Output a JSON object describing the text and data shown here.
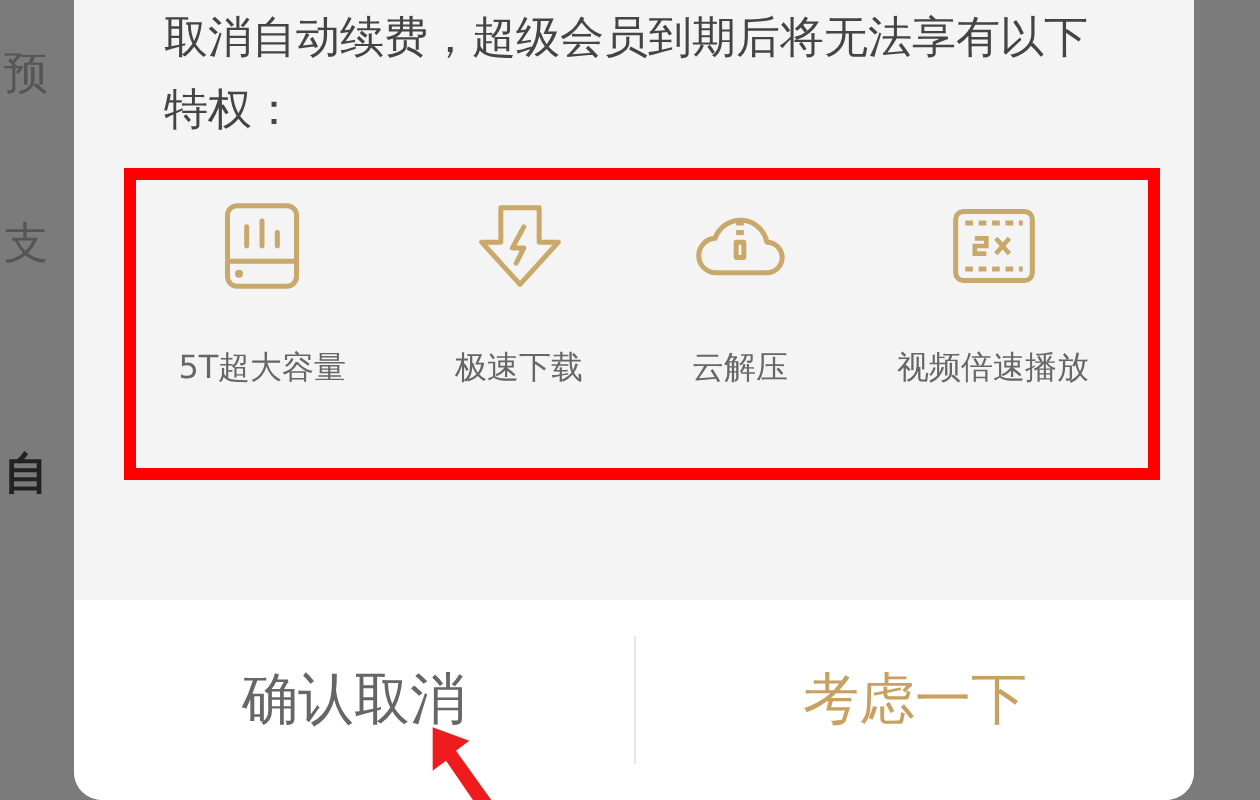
{
  "background_page": {
    "rows": [
      {
        "label": "预",
        "kind": "normal"
      },
      {
        "label": "支",
        "kind": "normal"
      },
      {
        "label": "自",
        "kind": "heading"
      }
    ]
  },
  "dialog": {
    "message": "取消自动续费，超级会员到期后将无法享有以下特权：",
    "privileges": [
      {
        "kind": "storage",
        "label": "5T超大容量"
      },
      {
        "kind": "download",
        "label": "极速下载"
      },
      {
        "kind": "cloud",
        "label": "云解压"
      },
      {
        "kind": "video",
        "label": "视频倍速播放"
      }
    ],
    "buttons": [
      {
        "label": "确认取消",
        "kind": "secondary"
      },
      {
        "label": "考虑一下",
        "kind": "primary"
      }
    ]
  }
}
